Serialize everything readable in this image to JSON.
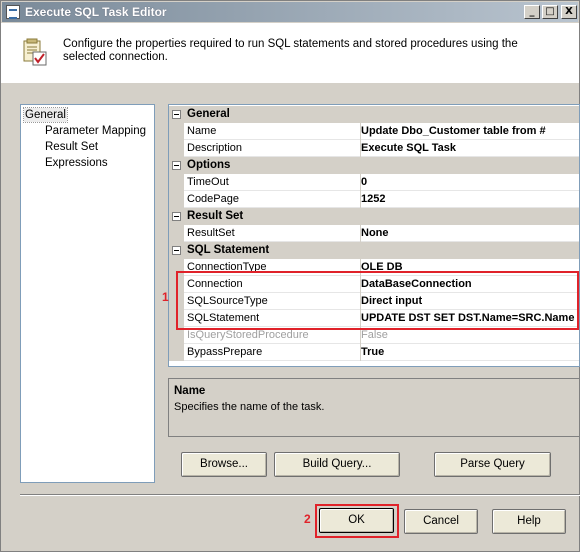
{
  "window": {
    "title": "Execute SQL Task Editor",
    "controls": {
      "minimize": "_",
      "maximize": "□",
      "close": "X"
    }
  },
  "header": {
    "description": "Configure the properties required to run SQL statements and stored procedures using the selected connection."
  },
  "nav": {
    "items": [
      {
        "label": "General",
        "selected": true
      },
      {
        "label": "Parameter Mapping"
      },
      {
        "label": "Result Set"
      },
      {
        "label": "Expressions"
      }
    ]
  },
  "grid": {
    "categories": {
      "general": "General",
      "options": "Options",
      "result_set": "Result Set",
      "sql_statement": "SQL Statement"
    },
    "props": {
      "name": {
        "name": "Name",
        "value": "Update Dbo_Customer table from #"
      },
      "description": {
        "name": "Description",
        "value": "Execute SQL Task"
      },
      "timeout": {
        "name": "TimeOut",
        "value": "0"
      },
      "codepage": {
        "name": "CodePage",
        "value": "1252"
      },
      "resultset": {
        "name": "ResultSet",
        "value": "None"
      },
      "connectiontype": {
        "name": "ConnectionType",
        "value": "OLE DB"
      },
      "connection": {
        "name": "Connection",
        "value": "DataBaseConnection"
      },
      "sqlsourcetype": {
        "name": "SQLSourceType",
        "value": "Direct input"
      },
      "sqlstatement": {
        "name": "SQLStatement",
        "value": "UPDATE DST SET DST.Name=SRC.Name"
      },
      "isquerystoredprocedure": {
        "name": "IsQueryStoredProcedure",
        "value": "False"
      },
      "bypassprepare": {
        "name": "BypassPrepare",
        "value": "True"
      }
    }
  },
  "help_panel": {
    "title": "Name",
    "text": "Specifies the name of the task."
  },
  "buttons": {
    "browse": "Browse...",
    "build_query": "Build Query...",
    "parse_query": "Parse Query",
    "ok": "OK",
    "cancel": "Cancel",
    "help": "Help"
  },
  "annotations": {
    "marker_1": "1",
    "marker_2": "2",
    "color": "#e0222a"
  }
}
